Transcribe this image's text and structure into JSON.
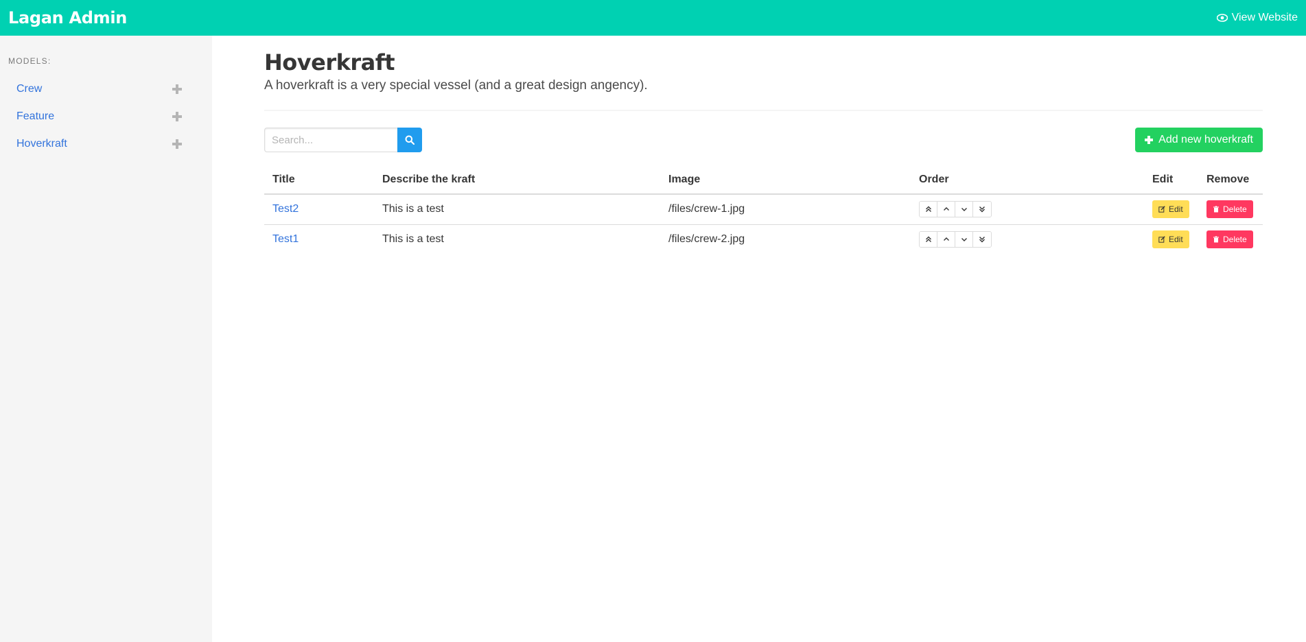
{
  "app": {
    "title": "Lagan Admin",
    "view_website_label": "View Website"
  },
  "sidebar": {
    "label": "MODELS:",
    "items": [
      {
        "label": "Crew"
      },
      {
        "label": "Feature"
      },
      {
        "label": "Hoverkraft"
      }
    ]
  },
  "page": {
    "title": "Hoverkraft",
    "subtitle": "A hoverkraft is a very special vessel (and a great design angency)."
  },
  "toolbar": {
    "search_placeholder": "Search...",
    "add_label": "Add new hoverkraft"
  },
  "table": {
    "columns": [
      "Title",
      "Describe the kraft",
      "Image",
      "Order",
      "Edit",
      "Remove"
    ],
    "rows": [
      {
        "title": "Test2",
        "description": "This is a test",
        "image": "/files/crew-1.jpg"
      },
      {
        "title": "Test1",
        "description": "This is a test",
        "image": "/files/crew-2.jpg"
      }
    ],
    "edit_label": "Edit",
    "delete_label": "Delete"
  },
  "colors": {
    "topbar": "#00d1b2",
    "link": "#3273dc",
    "search_button": "#209cee",
    "add_button": "#23d160",
    "edit_button": "#ffdd57",
    "delete_button": "#ff3860"
  }
}
